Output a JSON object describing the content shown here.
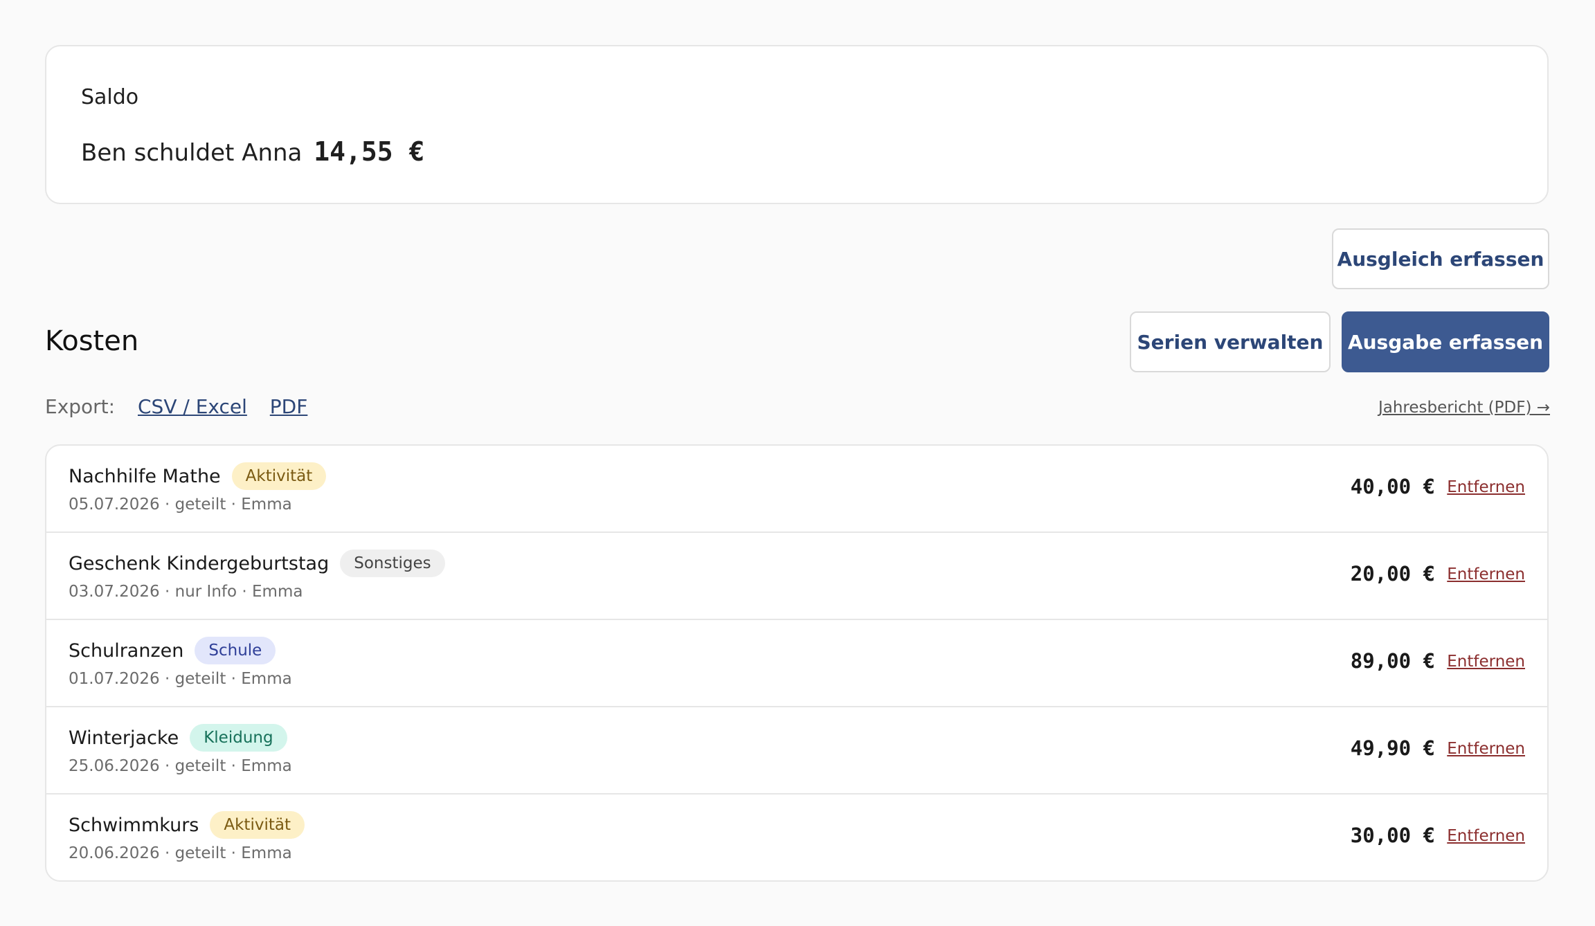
{
  "balance": {
    "label": "Saldo",
    "text": "Ben schuldet Anna",
    "amount": "14,55 €"
  },
  "buttons": {
    "settlement": "Ausgleich erfassen",
    "manage_series": "Serien verwalten",
    "add_expense": "Ausgabe erfassen"
  },
  "costs": {
    "title": "Kosten",
    "export_label": "Export:",
    "export_csv": "CSV / Excel",
    "export_pdf": "PDF",
    "yearly_report": "Jahresbericht (PDF) →",
    "remove_label": "Entfernen",
    "items": [
      {
        "title": "Nachhilfe Mathe",
        "category": "Aktivität",
        "meta": "05.07.2026 · geteilt · Emma",
        "amount": "40,00 €"
      },
      {
        "title": "Geschenk Kindergeburtstag",
        "category": "Sonstiges",
        "meta": "03.07.2026 · nur Info · Emma",
        "amount": "20,00 €"
      },
      {
        "title": "Schulranzen",
        "category": "Schule",
        "meta": "01.07.2026 · geteilt · Emma",
        "amount": "89,00 €"
      },
      {
        "title": "Winterjacke",
        "category": "Kleidung",
        "meta": "25.06.2026 · geteilt · Emma",
        "amount": "49,90 €"
      },
      {
        "title": "Schwimmkurs",
        "category": "Aktivität",
        "meta": "20.06.2026 · geteilt · Emma",
        "amount": "30,00 €"
      }
    ]
  },
  "colors": {
    "primary": "#3d5a91",
    "link": "#2c4677",
    "remove": "#8b2e2e",
    "badge_aktivitaet": {
      "bg": "#fdf0c7",
      "fg": "#7a5a12"
    },
    "badge_sonstiges": {
      "bg": "#efefef",
      "fg": "#444444"
    },
    "badge_schule": {
      "bg": "#e2e6fb",
      "fg": "#2f3f98"
    },
    "badge_kleidung": {
      "bg": "#d3f5ec",
      "fg": "#17715a"
    }
  }
}
